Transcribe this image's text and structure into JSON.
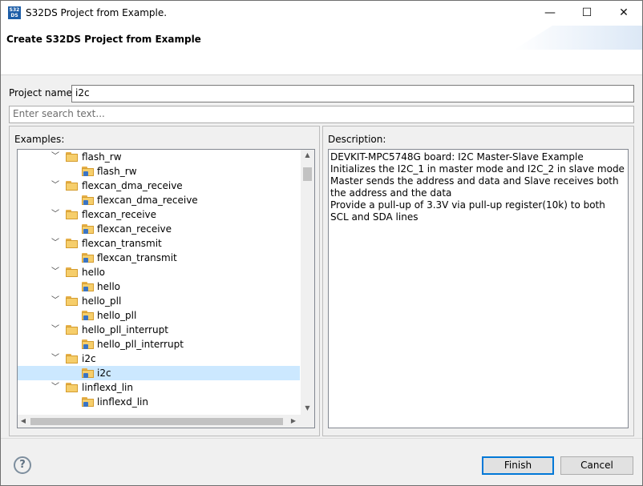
{
  "window": {
    "icon_text": "S32 DS",
    "title": "S32DS Project from Example.",
    "minimize_label": "—",
    "maximize_label": "☐",
    "close_label": "✕"
  },
  "header": {
    "title": "Create S32DS Project from Example"
  },
  "project_name": {
    "label": "Project name:",
    "value": "i2c"
  },
  "search": {
    "placeholder": "Enter search text..."
  },
  "examples": {
    "label": "Examples:",
    "items": [
      {
        "label": "flash_rw",
        "level": 0,
        "expanded": true
      },
      {
        "label": "flash_rw",
        "level": 1
      },
      {
        "label": "flexcan_dma_receive",
        "level": 0,
        "expanded": true
      },
      {
        "label": "flexcan_dma_receive",
        "level": 1
      },
      {
        "label": "flexcan_receive",
        "level": 0,
        "expanded": true
      },
      {
        "label": "flexcan_receive",
        "level": 1
      },
      {
        "label": "flexcan_transmit",
        "level": 0,
        "expanded": true
      },
      {
        "label": "flexcan_transmit",
        "level": 1
      },
      {
        "label": "hello",
        "level": 0,
        "expanded": true
      },
      {
        "label": "hello",
        "level": 1
      },
      {
        "label": "hello_pll",
        "level": 0,
        "expanded": true
      },
      {
        "label": "hello_pll",
        "level": 1
      },
      {
        "label": "hello_pll_interrupt",
        "level": 0,
        "expanded": true
      },
      {
        "label": "hello_pll_interrupt",
        "level": 1
      },
      {
        "label": "i2c",
        "level": 0,
        "expanded": true
      },
      {
        "label": "i2c",
        "level": 1,
        "selected": true
      },
      {
        "label": "linflexd_lin",
        "level": 0,
        "expanded": true
      },
      {
        "label": "linflexd_lin",
        "level": 1
      }
    ]
  },
  "description": {
    "label": "Description:",
    "lines": [
      "DEVKIT-MPC5748G board: I2C Master-Slave Example",
      "Initializes the I2C_1 in master mode and I2C_2 in slave mode",
      "Master sends the address and data and Slave receives both",
      "the address and the data",
      "Provide a pull-up of 3.3V via pull-up register(10k) to both",
      "SCL and SDA lines"
    ]
  },
  "footer": {
    "help_label": "?",
    "finish_label": "Finish",
    "cancel_label": "Cancel"
  },
  "colors": {
    "selection": "#cce8ff",
    "default_button_border": "#0078d7"
  }
}
